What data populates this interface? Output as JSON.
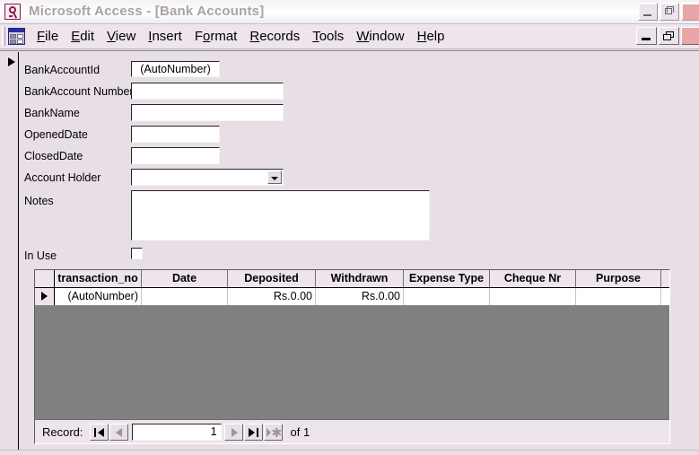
{
  "window": {
    "title": "Microsoft Access - [Bank Accounts]",
    "app_icon": "access-key-icon",
    "buttons": {
      "minimize": "minimize-icon",
      "restore": "restore-icon",
      "close": "close-icon"
    }
  },
  "menubar": {
    "doc_icon": "datasheet-form-icon",
    "items": [
      {
        "pre": "",
        "accel": "F",
        "post": "ile"
      },
      {
        "pre": "",
        "accel": "E",
        "post": "dit"
      },
      {
        "pre": "",
        "accel": "V",
        "post": "iew"
      },
      {
        "pre": "",
        "accel": "I",
        "post": "nsert"
      },
      {
        "pre": "F",
        "accel": "o",
        "post": "rmat"
      },
      {
        "pre": "",
        "accel": "R",
        "post": "ecords"
      },
      {
        "pre": "",
        "accel": "T",
        "post": "ools"
      },
      {
        "pre": "",
        "accel": "W",
        "post": "indow"
      },
      {
        "pre": "",
        "accel": "H",
        "post": "elp"
      }
    ],
    "doc_buttons": {
      "minimize": "minimize-icon",
      "restore": "restore-icon",
      "close": "close-icon"
    }
  },
  "form": {
    "fields": {
      "bank_account_id": {
        "label": "BankAccountId",
        "value": "(AutoNumber)"
      },
      "bank_account_number": {
        "label": "BankAccount Number",
        "value": ""
      },
      "bank_name": {
        "label": "BankName",
        "value": ""
      },
      "opened_date": {
        "label": "OpenedDate",
        "value": ""
      },
      "closed_date": {
        "label": "ClosedDate",
        "value": ""
      },
      "account_holder": {
        "label": "Account Holder",
        "value": ""
      },
      "notes": {
        "label": "Notes",
        "value": ""
      },
      "in_use": {
        "label": "In Use",
        "checked": false
      }
    }
  },
  "subform": {
    "columns": [
      "transaction_no",
      "Date",
      "Deposited",
      "Withdrawn",
      "Expense Type",
      "Cheque Nr",
      "Purpose"
    ],
    "rows": [
      {
        "transaction_no": "(AutoNumber)",
        "date": "",
        "deposited": "Rs.0.00",
        "withdrawn": "Rs.0.00",
        "expense_type": "",
        "cheque_nr": "",
        "purpose": ""
      }
    ],
    "navigator": {
      "label": "Record:",
      "current": "1",
      "of_text": "of 1",
      "first_btn": "first-record-icon",
      "prev_btn": "previous-record-icon",
      "next_btn": "next-record-icon",
      "last_btn": "last-record-icon",
      "new_btn": "new-record-icon"
    }
  },
  "colors": {
    "form_bg": "#e8dfe6",
    "menubar_bg": "#eee5ec",
    "datasheet_bg": "#808080",
    "title_text": "#a9a2a9",
    "close_btn": "#e8a6a6"
  }
}
